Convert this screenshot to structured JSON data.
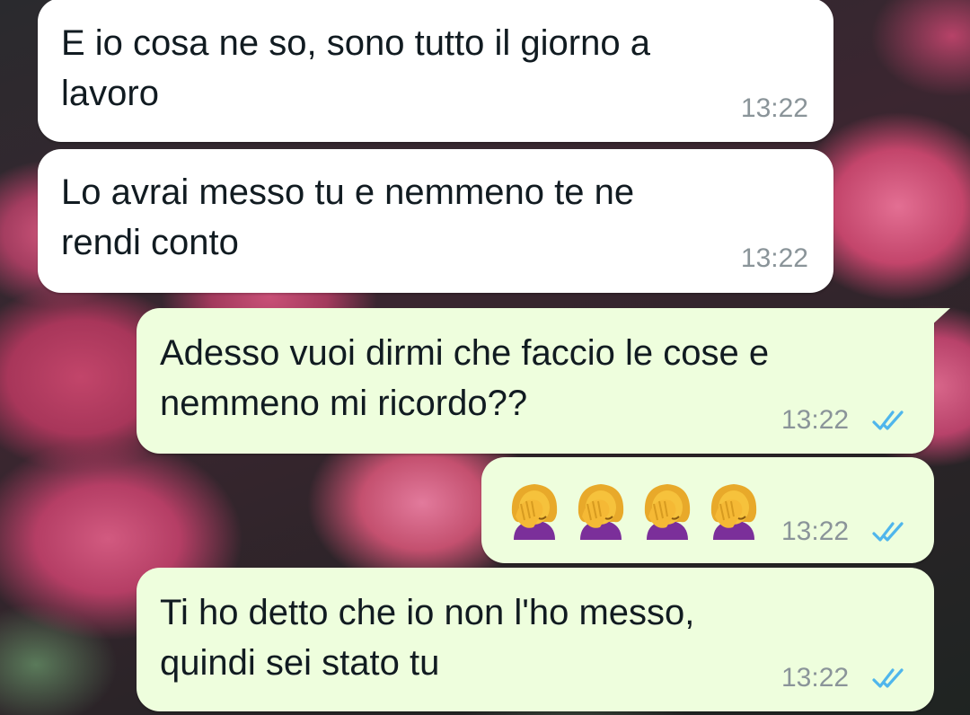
{
  "colors": {
    "incoming_bubble": "#ffffff",
    "outgoing_bubble": "#eefedd",
    "read_ticks": "#4fb6ec",
    "timestamp": "#8a9499"
  },
  "messages": [
    {
      "direction": "incoming",
      "text": "E io cosa ne so, sono tutto il giorno a\nlavoro",
      "time": "13:22"
    },
    {
      "direction": "incoming",
      "text": "Lo avrai messo tu e nemmeno te ne\nrendi conto",
      "time": "13:22"
    },
    {
      "direction": "outgoing",
      "text": "Adesso vuoi dirmi che faccio le cose e\nnemmeno mi ricordo??",
      "time": "13:22",
      "status_icon": "double-check-read-icon"
    },
    {
      "direction": "outgoing",
      "emoji": [
        "woman-facepalming",
        "woman-facepalming",
        "woman-facepalming",
        "woman-facepalming"
      ],
      "time": "13:22",
      "status_icon": "double-check-read-icon"
    },
    {
      "direction": "outgoing",
      "text": "Ti ho detto che io non l'ho messo,\nquindi sei stato tu",
      "time": "13:22",
      "status_icon": "double-check-read-icon"
    }
  ]
}
